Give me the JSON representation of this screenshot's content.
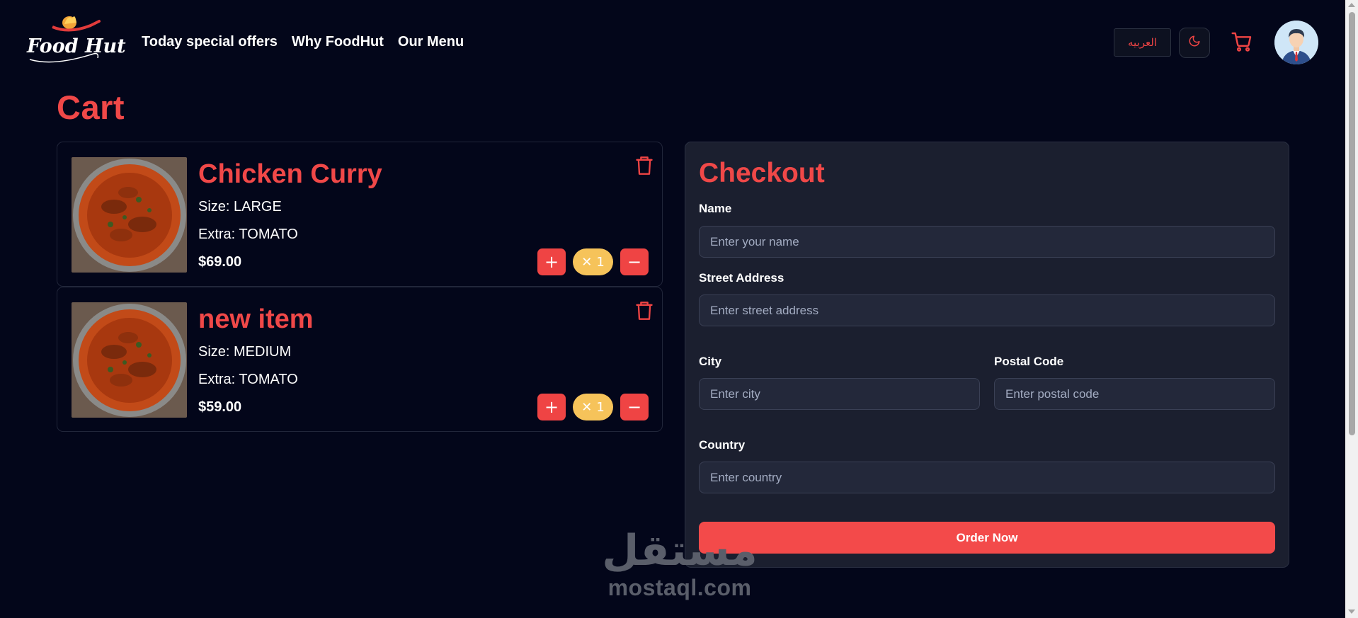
{
  "header": {
    "logo_text": "Food Hut",
    "nav": [
      "Today special offers",
      "Why FoodHut",
      "Our Menu"
    ],
    "language_button": "العربيه",
    "theme_icon": "moon-icon",
    "cart_icon": "cart-icon",
    "avatar_icon": "user-avatar"
  },
  "page_title": "Cart",
  "cart_items": [
    {
      "name": "Chicken Curry",
      "size": "Size: LARGE",
      "extra": "Extra: TOMATO",
      "price": "$69.00",
      "quantity": "1"
    },
    {
      "name": "new item",
      "size": "Size: MEDIUM",
      "extra": "Extra: TOMATO",
      "price": "$59.00",
      "quantity": "1"
    }
  ],
  "checkout": {
    "title": "Checkout",
    "name_label": "Name",
    "name_placeholder": "Enter your name",
    "street_label": "Street Address",
    "street_placeholder": "Enter street address",
    "city_label": "City",
    "city_placeholder": "Enter city",
    "postal_label": "Postal Code",
    "postal_placeholder": "Enter postal code",
    "country_label": "Country",
    "country_placeholder": "Enter country",
    "order_button": "Order Now"
  },
  "watermark": {
    "arabic": "مستقل",
    "latin": "mostaql.com"
  },
  "colors": {
    "accent": "#ef4444",
    "background": "#03061a",
    "panel": "#1b1f2f",
    "quantity_badge": "#f6c35a"
  }
}
